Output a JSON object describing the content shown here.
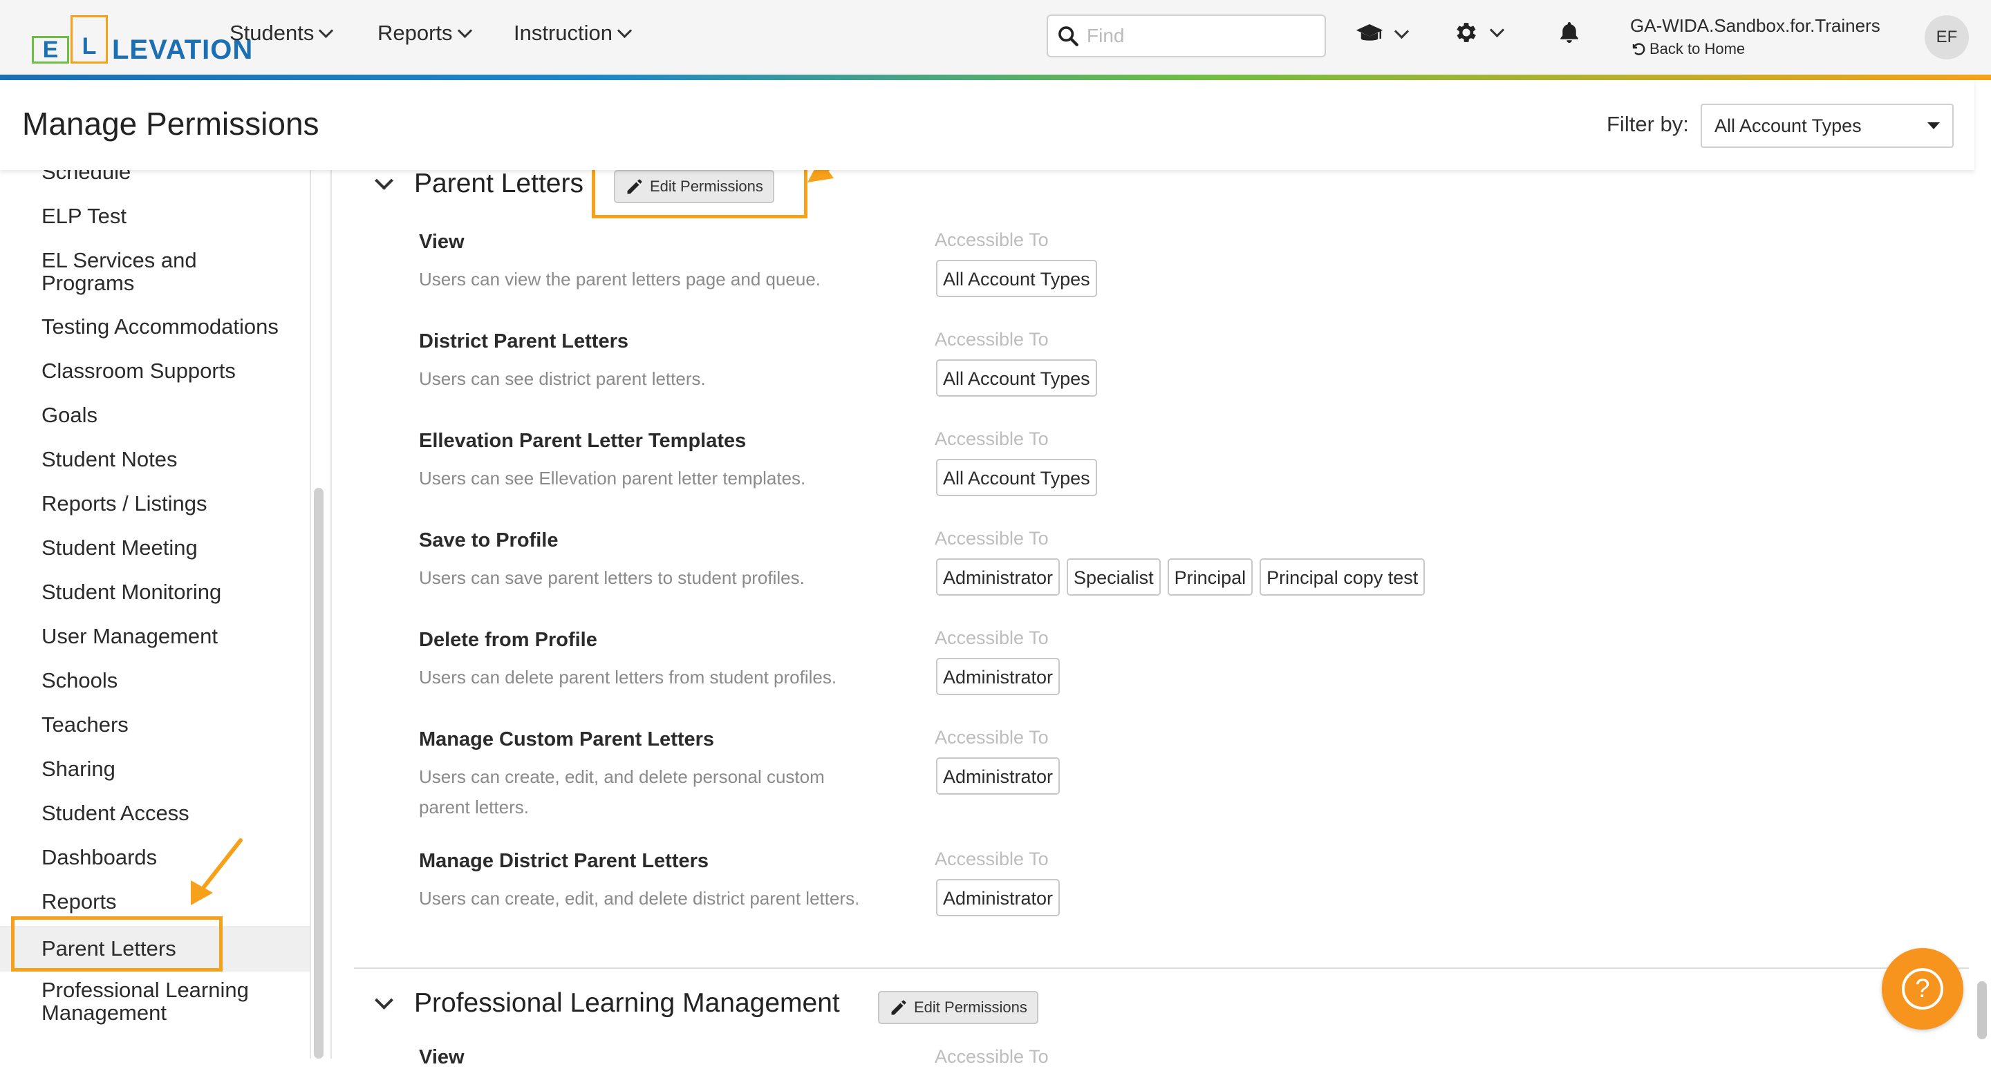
{
  "nav": {
    "logo": "ELLEVATION",
    "menu": [
      {
        "label": "Students"
      },
      {
        "label": "Reports"
      },
      {
        "label": "Instruction"
      }
    ],
    "search_placeholder": "Find",
    "account": "GA-WIDA.Sandbox.for.Trainers",
    "back_home": "Back to Home",
    "avatar_initials": "EF"
  },
  "header": {
    "title": "Manage Permissions",
    "filter_label": "Filter by:",
    "filter_value": "All Account Types"
  },
  "sidebar": {
    "items": [
      {
        "label": "Schedule"
      },
      {
        "label": "ELP Test"
      },
      {
        "label": "EL Services and Programs"
      },
      {
        "label": "Testing Accommodations"
      },
      {
        "label": "Classroom Supports"
      },
      {
        "label": "Goals"
      },
      {
        "label": "Student Notes"
      },
      {
        "label": "Reports / Listings"
      },
      {
        "label": "Student Meeting"
      },
      {
        "label": "Student Monitoring"
      },
      {
        "label": "User Management"
      },
      {
        "label": "Schools"
      },
      {
        "label": "Teachers"
      },
      {
        "label": "Sharing"
      },
      {
        "label": "Student Access"
      },
      {
        "label": "Dashboards"
      },
      {
        "label": "Reports"
      },
      {
        "label": "Parent Letters"
      },
      {
        "label": "Professional Learning Management"
      }
    ],
    "active": "Parent Letters"
  },
  "sections": [
    {
      "title": "Parent Letters",
      "edit_label": "Edit Permissions",
      "accessible_label": "Accessible To",
      "permissions": [
        {
          "title": "View",
          "desc": "Users can view the parent letters page and queue.",
          "roles": [
            "All Account Types"
          ]
        },
        {
          "title": "District Parent Letters",
          "desc": "Users can see district parent letters.",
          "roles": [
            "All Account Types"
          ]
        },
        {
          "title": "Ellevation Parent Letter Templates",
          "desc": "Users can see Ellevation parent letter templates.",
          "roles": [
            "All Account Types"
          ]
        },
        {
          "title": "Save to Profile",
          "desc": "Users can save parent letters to student profiles.",
          "roles": [
            "Administrator",
            "Specialist",
            "Principal",
            "Principal copy test"
          ]
        },
        {
          "title": "Delete from Profile",
          "desc": "Users can delete parent letters from student profiles.",
          "roles": [
            "Administrator"
          ]
        },
        {
          "title": "Manage Custom Parent Letters",
          "desc": "Users can create, edit, and delete personal custom parent letters.",
          "roles": [
            "Administrator"
          ]
        },
        {
          "title": "Manage District Parent Letters",
          "desc": "Users can create, edit, and delete district parent letters.",
          "roles": [
            "Administrator"
          ]
        }
      ]
    },
    {
      "title": "Professional Learning Management",
      "edit_label": "Edit Permissions",
      "accessible_label": "Accessible To",
      "permissions": [
        {
          "title": "View"
        }
      ]
    }
  ],
  "colors": {
    "accent_orange": "#f7a11a",
    "brand_blue": "#1b6fb3",
    "brand_green": "#6fbe44"
  },
  "icons": [
    "search-icon",
    "graduation-cap-icon",
    "gear-icon",
    "bell-icon",
    "undo-icon",
    "pencil-icon",
    "chevron-down-icon",
    "help-icon"
  ]
}
